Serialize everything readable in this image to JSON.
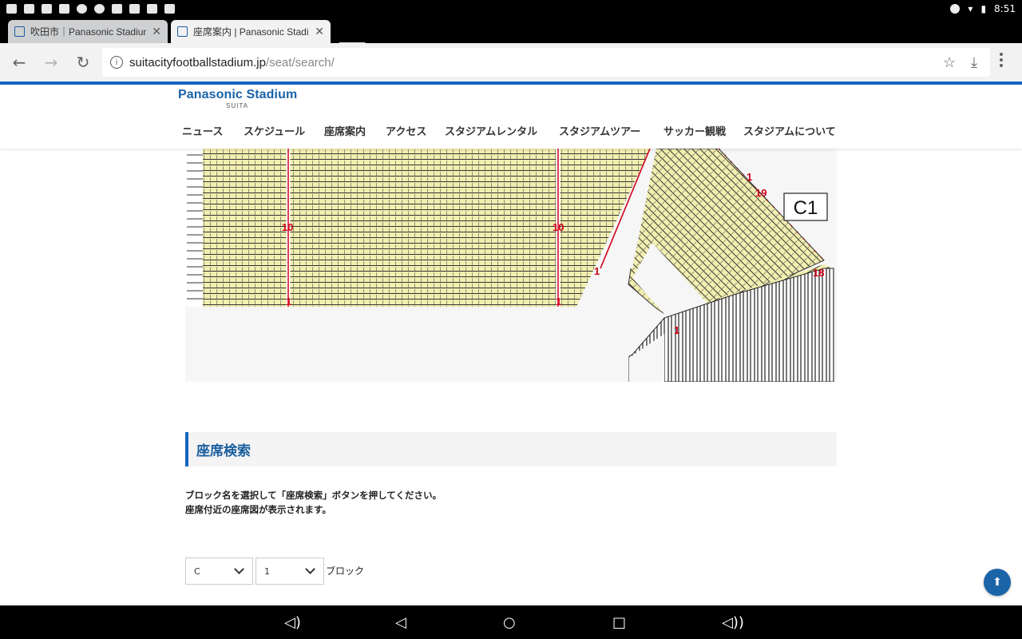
{
  "statusbar": {
    "time": "8:51"
  },
  "tabs": [
    {
      "title": "吹田市｜Panasonic Stadium S"
    },
    {
      "title": "座席案内 | Panasonic Stadium"
    }
  ],
  "omnibox": {
    "host": "suitacityfootballstadium.jp",
    "path": "/seat/search/"
  },
  "header": {
    "logo": "Panasonic Stadium",
    "logo_sub": "SUITA",
    "nav": [
      "ニュース",
      "スケジュール",
      "座席案内",
      "アクセス",
      "スタジアムレンタル",
      "スタジアムツアー",
      "サッカー観戦",
      "スタジアムについて"
    ]
  },
  "seatmap": {
    "block_label": "C1",
    "row_markers": [
      "10",
      "10",
      "1",
      "1",
      "1",
      "19",
      "1",
      "18",
      "1"
    ]
  },
  "section": {
    "title": "座席検索",
    "desc_line1": "ブロック名を選択して「座席検索」ボタンを押してください。",
    "desc_line2": "座席付近の座席図が表示されます。"
  },
  "search": {
    "block_letter": "C",
    "block_number": "1",
    "suffix": "ブロック"
  },
  "colors": {
    "accent": "#1565c0",
    "seat_fill": "#f2eeb0",
    "row_line": "#d0021b"
  }
}
